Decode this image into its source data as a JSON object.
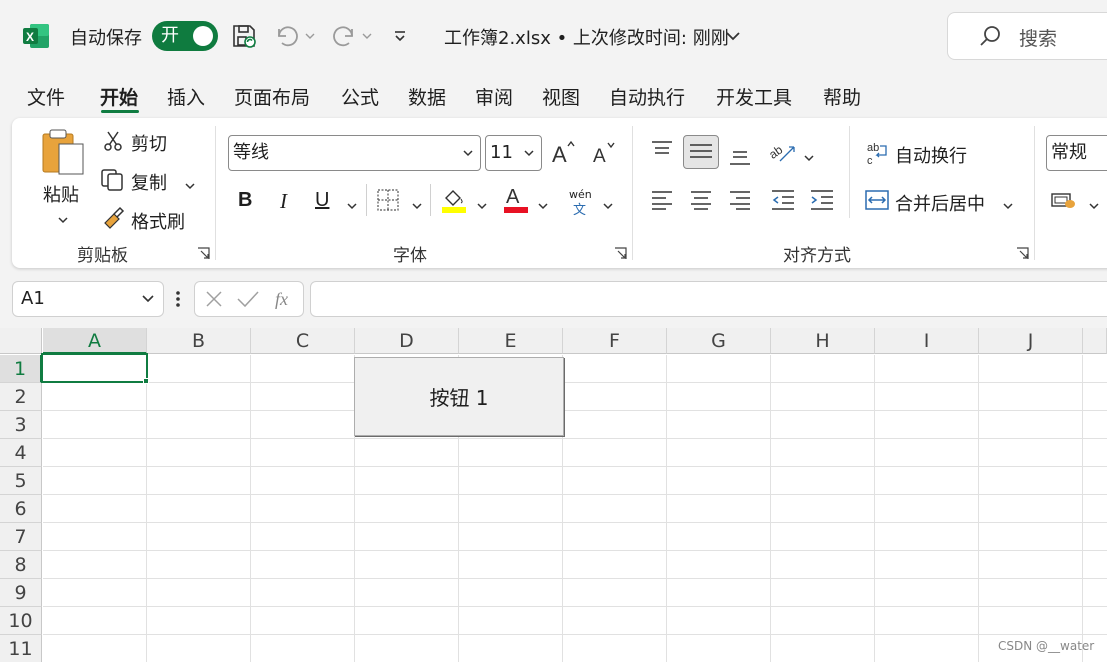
{
  "titlebar": {
    "autosave_label": "自动保存",
    "autosave_state": "开",
    "doc_title": "工作簿2.xlsx • 上次修改时间: 刚刚",
    "search_placeholder": "搜索"
  },
  "tabs": [
    "文件",
    "开始",
    "插入",
    "页面布局",
    "公式",
    "数据",
    "审阅",
    "视图",
    "自动执行",
    "开发工具",
    "帮助"
  ],
  "active_tab": "开始",
  "ribbon": {
    "clipboard": {
      "label": "剪贴板",
      "paste": "粘贴",
      "cut": "剪切",
      "copy": "复制",
      "format_painter": "格式刷"
    },
    "font": {
      "label": "字体",
      "font_name": "等线",
      "font_size": "11",
      "bold": "B",
      "italic": "I",
      "underline": "U",
      "font_color_letter": "A",
      "phonetic": "wén",
      "phonetic_char": "文"
    },
    "alignment": {
      "label": "对齐方式",
      "wrap_text": "自动换行",
      "merge_center": "合并后居中"
    },
    "number": {
      "format": "常规"
    }
  },
  "formula_bar": {
    "name_box": "A1",
    "formula": ""
  },
  "grid": {
    "columns": [
      "A",
      "B",
      "C",
      "D",
      "E",
      "F",
      "G",
      "H",
      "I",
      "J"
    ],
    "rows": [
      "1",
      "2",
      "3",
      "4",
      "5",
      "6",
      "7",
      "8",
      "9",
      "10",
      "11"
    ],
    "active_cell": "A1",
    "form_button_label": "按钮 1"
  },
  "watermark": "CSDN @__water",
  "colors": {
    "accent": "#107c41",
    "toggle": "#0f7b3f",
    "highlight": "#ffff00",
    "font_color": "#e81123"
  }
}
